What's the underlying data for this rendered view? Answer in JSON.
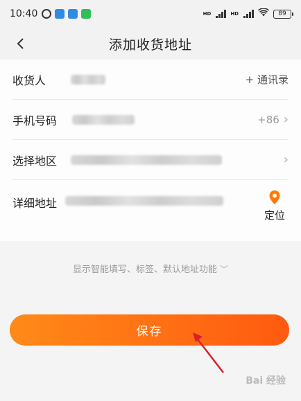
{
  "status_bar": {
    "time": "10:40",
    "battery": "89"
  },
  "header": {
    "title": "添加收货地址"
  },
  "form": {
    "recipient": {
      "label": "收货人",
      "action": "+ 通讯录"
    },
    "phone": {
      "label": "手机号码",
      "country_code": "+86"
    },
    "region": {
      "label": "选择地区"
    },
    "address": {
      "label": "详细地址",
      "locate_label": "定位"
    }
  },
  "smart_fill_toggle": "显示智能填写、标签、默认地址功能",
  "save_label": "保存",
  "watermark": "Bai 经验",
  "colors": {
    "accent_start": "#ff8a18",
    "accent_end": "#ff5a10",
    "pin": "#ff7a00",
    "arrow": "#d9202a"
  }
}
